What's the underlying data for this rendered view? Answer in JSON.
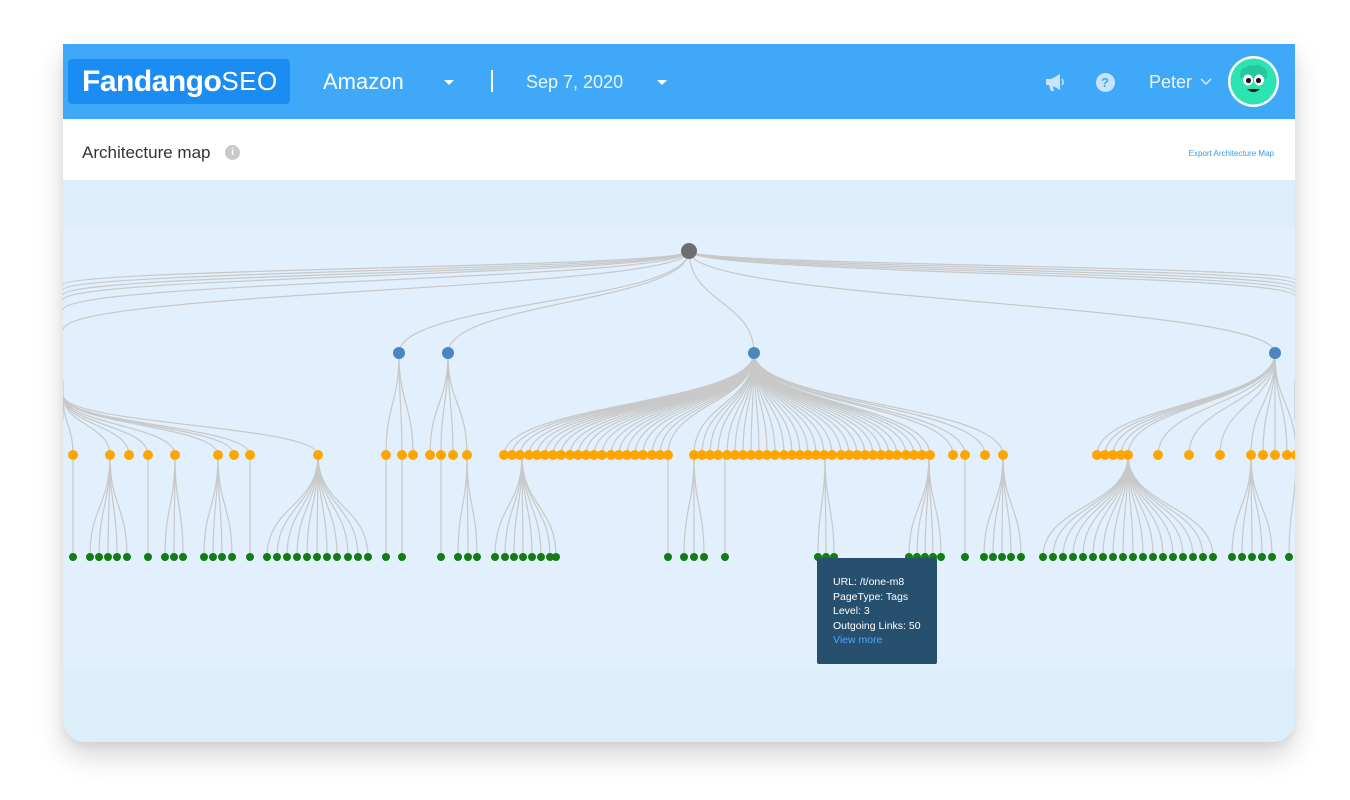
{
  "header": {
    "logo_bold": "Fandango",
    "logo_light": "SEO",
    "site": "Amazon",
    "date": "Sep 7, 2020",
    "user": "Peter",
    "icons": [
      "megaphone-icon",
      "help-icon",
      "chevron-down-icon",
      "avatar-icon"
    ]
  },
  "page": {
    "title": "Architecture map",
    "export_label": "Export Architecture Map"
  },
  "tooltip": {
    "url": "URL: /t/one-m8",
    "page_type": "PageType: Tags",
    "level": "Level: 3",
    "outgoing_links": "Outgoing Links: 50",
    "view_more": "View more"
  },
  "colors": {
    "header": "#3fa8f8",
    "logo_bg": "#1b8df2",
    "map_bg": "#ddeefb",
    "edge": "#c8c8c8",
    "root_node": "#6e6e6e",
    "level1_node": "#4a86c0",
    "level2_node": "#ffa500",
    "level3_node": "#137d13",
    "tooltip_bg": "#27506f",
    "link": "#4aa7ff"
  }
}
